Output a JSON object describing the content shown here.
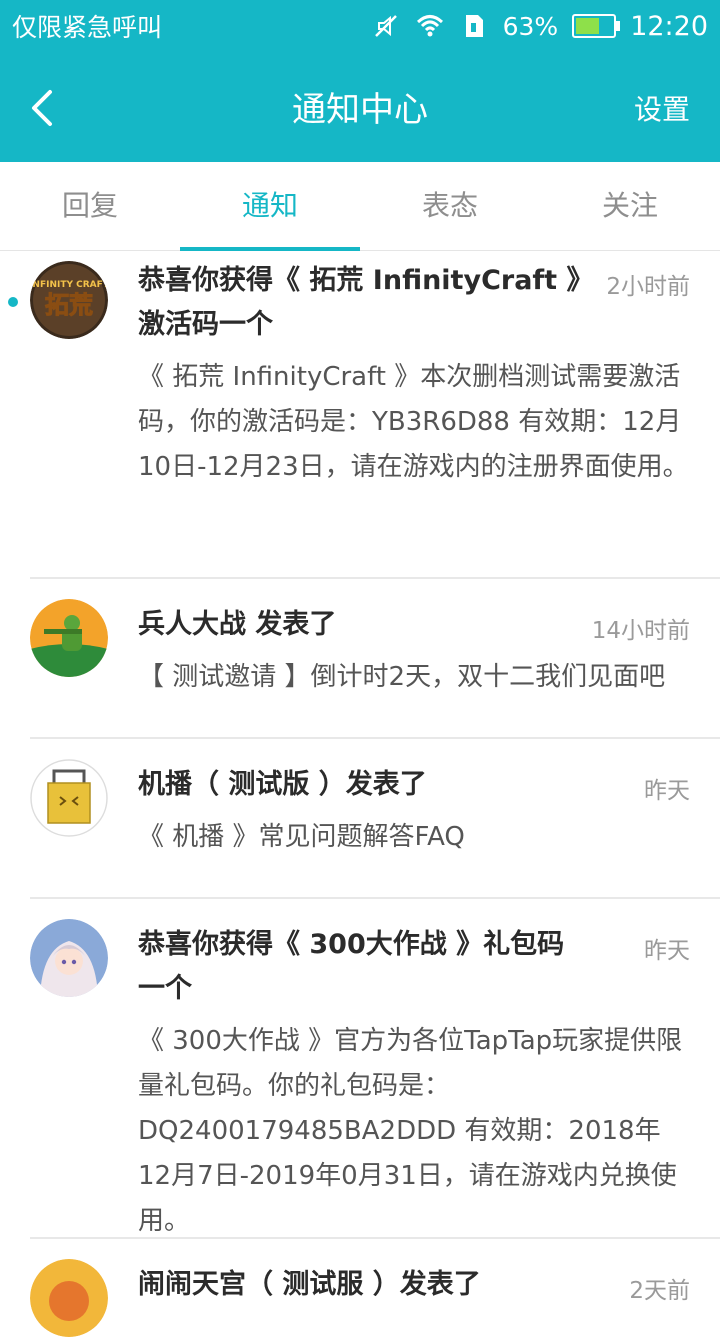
{
  "status_bar": {
    "carrier": "仅限紧急呼叫",
    "battery_percent": "63%",
    "battery_level": 0.63,
    "time": "12:20"
  },
  "nav": {
    "title": "通知中心",
    "settings_label": "设置"
  },
  "tabs": [
    {
      "label": "回复",
      "active": false
    },
    {
      "label": "通知",
      "active": true
    },
    {
      "label": "表态",
      "active": false
    },
    {
      "label": "关注",
      "active": false
    }
  ],
  "notifications": [
    {
      "title": "恭喜你获得《 拓荒 InfinityCraft 》激活码一个",
      "time": "2小时前",
      "body": "《 拓荒 InfinityCraft 》本次删档测试需要激活码，你的激活码是：YB3R6D88 有效期：12月10日-12月23日，请在游戏内的注册界面使用。",
      "unread": true,
      "avatar_text": "拓荒",
      "avatar_subtext": "INFINITY CRAFT"
    },
    {
      "title": "兵人大战 发表了",
      "time": "14小时前",
      "body": "【 测试邀请 】倒计时2天，双十二我们见面吧",
      "unread": false
    },
    {
      "title": "机播（ 测试版 ）发表了",
      "time": "昨天",
      "body": "《 机播 》常见问题解答FAQ",
      "unread": false
    },
    {
      "title": "恭喜你获得《 300大作战 》礼包码一个",
      "time": "昨天",
      "body": "《 300大作战 》官方为各位TapTap玩家提供限量礼包码。你的礼包码是：DQ2400179485BA2DDD 有效期：2018年12月7日-2019年0月31日，请在游戏内兑换使用。",
      "unread": false
    },
    {
      "title": "闹闹天宫（ 测试服 ）发表了",
      "time": "2天前",
      "body": "",
      "unread": false
    }
  ],
  "colors": {
    "accent": "#15b7c6",
    "divider": "#e8e8e8"
  }
}
